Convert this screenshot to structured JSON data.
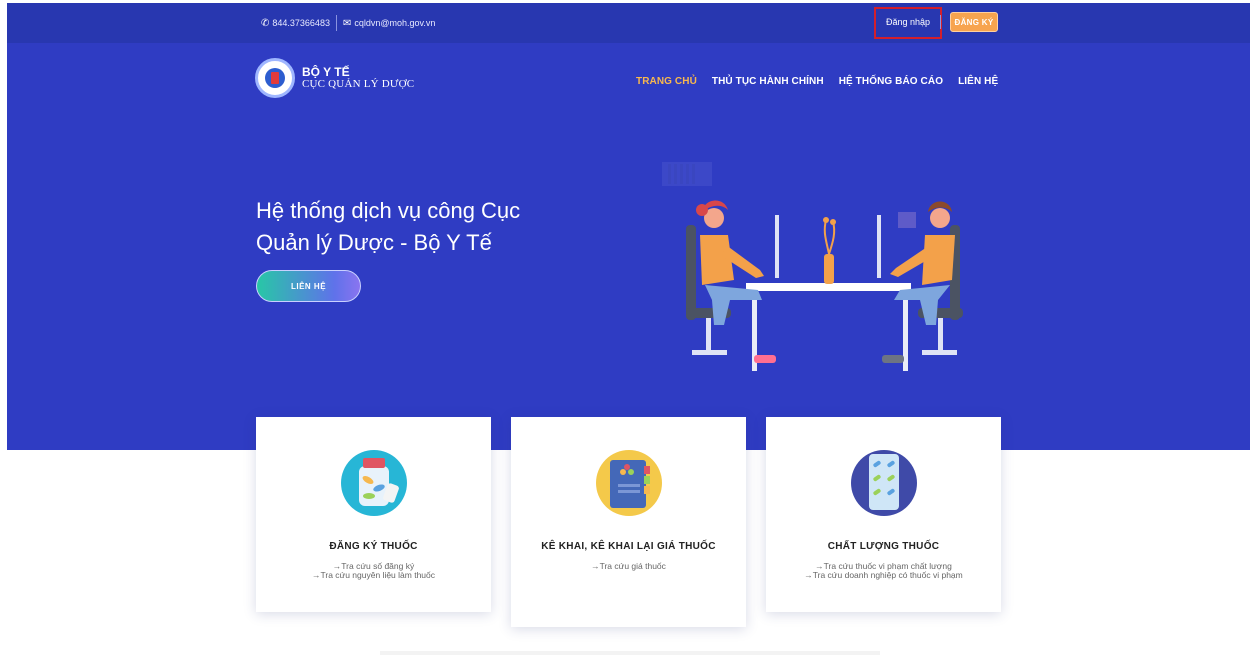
{
  "topbar": {
    "phone": "844.37366483",
    "email": "cqldvn@moh.gov.vn",
    "login": "Đăng nhập",
    "register": "ĐĂNG KÝ"
  },
  "logo": {
    "title": "BỘ Y TẾ",
    "subtitle": "CỤC QUẢN LÝ DƯỢC"
  },
  "nav": {
    "items": [
      "TRANG CHỦ",
      "THỦ TỤC HÀNH CHÍNH",
      "HỆ THỐNG BÁO CÁO",
      "LIÊN HỆ"
    ],
    "active_index": 0
  },
  "hero": {
    "title_line1": "Hệ thống dịch vụ công Cục",
    "title_line2": "Quản lý Dược - Bộ Y Tế",
    "button": "LIÊN HỆ"
  },
  "cards": [
    {
      "title": "ĐĂNG KÝ THUỐC",
      "links": [
        "→Tra cứu số đăng ký",
        "→Tra cứu nguyên liệu làm thuốc"
      ],
      "icon": "pill-bottle-icon"
    },
    {
      "title": "KÊ KHAI, KÊ KHAI LẠI GIÁ THUỐC",
      "links": [
        "→Tra cứu giá thuốc"
      ],
      "icon": "price-book-icon"
    },
    {
      "title": "CHẤT LƯỢNG THUỐC",
      "links": [
        "→Tra cứu thuốc vi phạm chất lượng",
        "→Tra cứu doanh nghiệp có thuốc vi phạm"
      ],
      "icon": "pill-blister-icon"
    }
  ],
  "colors": {
    "hero_bg": "#2f3cc3",
    "topbar_bg": "#2837b0",
    "accent_orange": "#f7a44f",
    "nav_active": "#f8b84e",
    "highlight_border": "#d31f2b"
  }
}
